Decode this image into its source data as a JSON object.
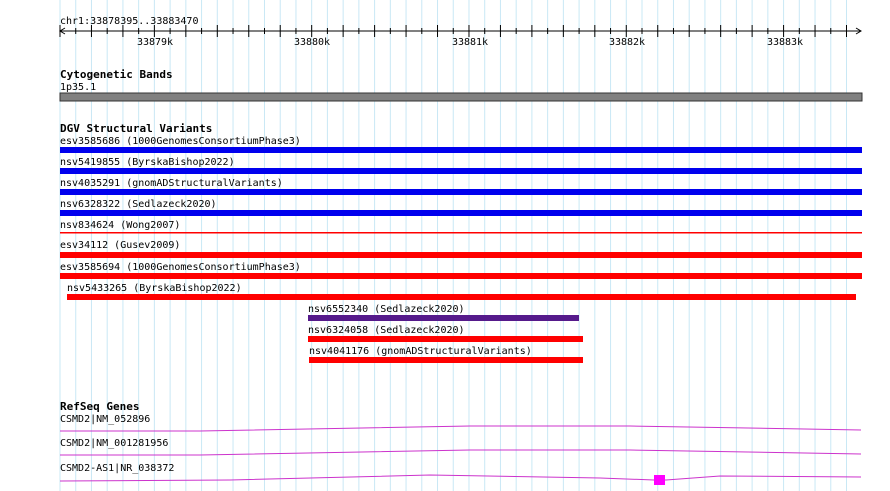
{
  "ruler": {
    "range_label": "chr1:33878395..33883470",
    "tick_labels": [
      "33879k",
      "33880k",
      "33881k",
      "33882k",
      "33883k"
    ]
  },
  "tracks": {
    "cytoband": {
      "title": "Cytogenetic Bands",
      "band_label": "1p35.1",
      "band_color": "#808080"
    },
    "dgv": {
      "title": "DGV Structural Variants",
      "colors": {
        "blue": "#0000ee",
        "red": "#ff0000",
        "purple": "#551a8b"
      },
      "features": [
        {
          "label": "esv3585686 (1000GenomesConsortiumPhase3)",
          "color": "blue"
        },
        {
          "label": "nsv5419855 (ByrskaBishop2022)",
          "color": "blue"
        },
        {
          "label": "nsv4035291 (gnomADStructuralVariants)",
          "color": "blue"
        },
        {
          "label": "nsv6328322 (Sedlazeck2020)",
          "color": "blue"
        },
        {
          "label": "nsv834624 (Wong2007)",
          "color": "red"
        },
        {
          "label": "esv34112 (Gusev2009)",
          "color": "red"
        },
        {
          "label": "esv3585694 (1000GenomesConsortiumPhase3)",
          "color": "red"
        },
        {
          "label": "nsv5433265 (ByrskaBishop2022)",
          "color": "red"
        },
        {
          "label": "nsv6552340 (Sedlazeck2020)",
          "color": "purple"
        },
        {
          "label": "nsv6324058 (Sedlazeck2020)",
          "color": "red"
        },
        {
          "label": "nsv4041176 (gnomADStructuralVariants)",
          "color": "red"
        }
      ]
    },
    "refseq": {
      "title": "RefSeq Genes",
      "color": "#cc33cc",
      "exon_color": "#ff00ff",
      "genes": [
        {
          "label": "CSMD2|NM_052896"
        },
        {
          "label": "CSMD2|NM_001281956"
        },
        {
          "label": "CSMD2-AS1|NR_038372"
        }
      ]
    }
  }
}
